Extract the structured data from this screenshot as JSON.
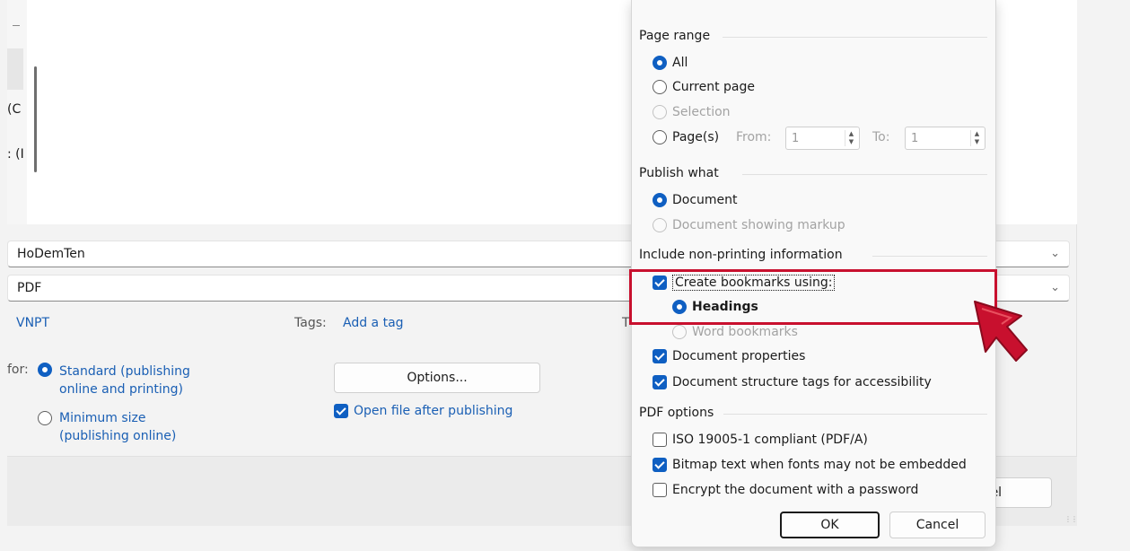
{
  "background_dialog": {
    "nav_fragments": [
      "(C",
      ": (I"
    ],
    "filename_value": "HoDemTen",
    "filetype_value": "PDF",
    "authors_value": "VNPT",
    "tags_label": "Tags:",
    "tags_placeholder": "Add a tag",
    "title_fragment": "T",
    "optimize_label": "for:",
    "optimize_standard_line1": "Standard (publishing",
    "optimize_standard_line2": "online and printing)",
    "optimize_minimum_line1": "Minimum size",
    "optimize_minimum_line2": "(publishing online)",
    "options_button": "Options...",
    "open_after_label": "Open file after publishing",
    "cancel_fragment": "ncel"
  },
  "options_dialog": {
    "page_range": {
      "title": "Page range",
      "all": "All",
      "current_page": "Current page",
      "selection": "Selection",
      "pages": "Page(s)",
      "from_label": "From:",
      "from_value": "1",
      "to_label": "To:",
      "to_value": "1"
    },
    "publish_what": {
      "title": "Publish what",
      "document": "Document",
      "document_markup": "Document showing markup"
    },
    "non_printing": {
      "title": "Include non-printing information",
      "create_bookmarks": "Create bookmarks using:",
      "headings": "Headings",
      "word_bookmarks": "Word bookmarks",
      "document_properties": "Document properties",
      "structure_tags": "Document structure tags for accessibility"
    },
    "pdf_options": {
      "title": "PDF options",
      "iso": "ISO 19005-1 compliant (PDF/A)",
      "bitmap_text": "Bitmap text when fonts may not be embedded",
      "encrypt": "Encrypt the document with a password"
    },
    "ok_button": "OK",
    "cancel_button": "Cancel"
  },
  "colors": {
    "accent": "#0f5fc2",
    "highlight": "#c8102e",
    "arrow": "#c8102e"
  },
  "icons": {
    "dropdown": "chevron-down-icon",
    "pointer": "arrow-pointer-icon"
  }
}
